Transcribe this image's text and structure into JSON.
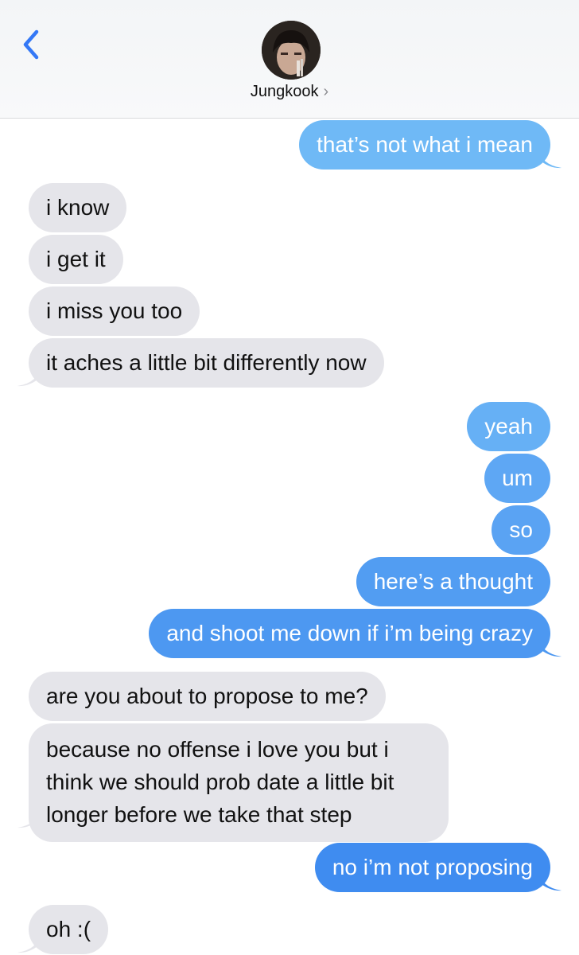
{
  "colors": {
    "sent_bubble_gradient": [
      "#6fb9f6",
      "#66b0f5",
      "#5ea7f4",
      "#4d98f1",
      "#4592f1",
      "#3f8cf0",
      "#3b86ef"
    ],
    "received_bubble": "#e5e5ea",
    "accent_blue": "#3478f6"
  },
  "header": {
    "back_icon": "chevron-left-icon",
    "contact_name": "Jungkook",
    "chevron": "›"
  },
  "messages": [
    {
      "from": "me",
      "text": "that’s not what i mean"
    },
    {
      "from": "them",
      "text": "i know"
    },
    {
      "from": "them",
      "text": "i get it"
    },
    {
      "from": "them",
      "text": "i miss you too"
    },
    {
      "from": "them",
      "text": "it aches a little bit differently now"
    },
    {
      "from": "me",
      "text": "yeah"
    },
    {
      "from": "me",
      "text": "um"
    },
    {
      "from": "me",
      "text": "so"
    },
    {
      "from": "me",
      "text": "here’s a thought"
    },
    {
      "from": "me",
      "text": "and shoot me down if i’m being crazy"
    },
    {
      "from": "them",
      "text": "are you about to propose to me?"
    },
    {
      "from": "them",
      "text": "because no offense i love you but i think we should prob date a little bit longer before we take that step"
    },
    {
      "from": "me",
      "text": "no i’m not proposing"
    },
    {
      "from": "them",
      "text": "oh :("
    }
  ]
}
